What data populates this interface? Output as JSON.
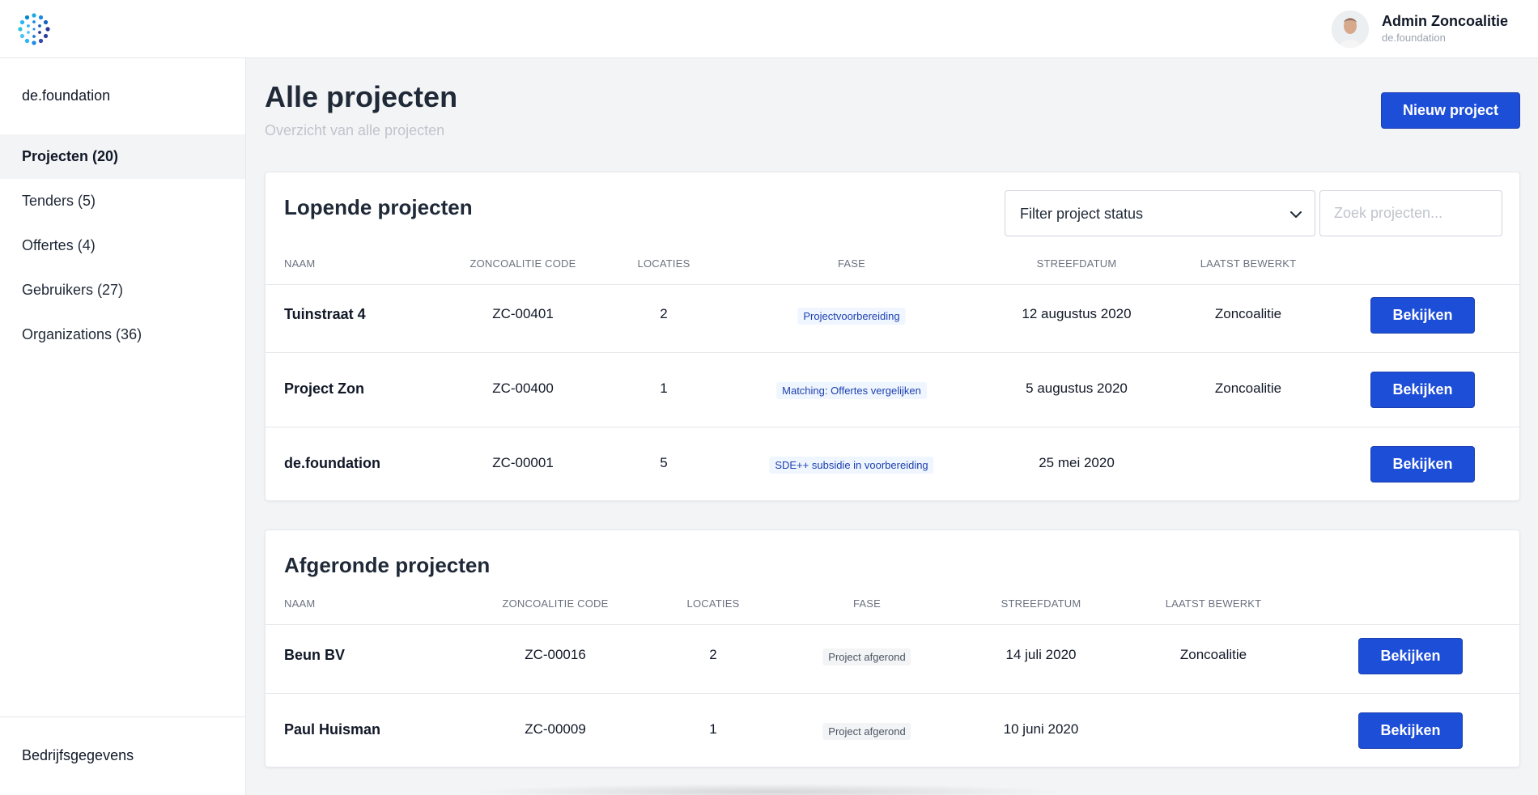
{
  "user": {
    "name": "Admin Zoncoalitie",
    "org": "de.foundation"
  },
  "sidebar": {
    "org_name": "de.foundation",
    "items": [
      {
        "label": "Projecten (20)",
        "active": true
      },
      {
        "label": "Tenders (5)"
      },
      {
        "label": "Offertes (4)"
      },
      {
        "label": "Gebruikers (27)"
      },
      {
        "label": "Organizations (36)"
      }
    ],
    "footer_label": "Bedrijfsgegevens"
  },
  "page": {
    "title": "Alle projecten",
    "subtitle": "Overzicht van alle projecten",
    "new_button": "Nieuw project"
  },
  "running": {
    "title": "Lopende projecten",
    "filter_label": "Filter project status",
    "search_placeholder": "Zoek projecten...",
    "columns": [
      "Naam",
      "Zoncoalitie code",
      "Locaties",
      "Fase",
      "Streefdatum",
      "Laatst bewerkt"
    ],
    "rows": [
      {
        "name": "Tuinstraat 4",
        "code": "ZC-00401",
        "locations": "2",
        "phase": "Projectvoorbereiding",
        "target_date": "12 augustus 2020",
        "last_edited": "Zoncoalitie",
        "action": "Bekijken"
      },
      {
        "name": "Project Zon",
        "code": "ZC-00400",
        "locations": "1",
        "phase": "Matching: Offertes vergelijken",
        "target_date": "5 augustus 2020",
        "last_edited": "Zoncoalitie",
        "action": "Bekijken"
      },
      {
        "name": "de.foundation",
        "code": "ZC-00001",
        "locations": "5",
        "phase": "SDE++ subsidie in voorbereiding",
        "target_date": "25 mei 2020",
        "last_edited": "",
        "action": "Bekijken"
      }
    ]
  },
  "completed": {
    "title": "Afgeronde projecten",
    "columns": [
      "Naam",
      "Zoncoalitie code",
      "Locaties",
      "Fase",
      "Streefdatum",
      "Laatst bewerkt"
    ],
    "rows": [
      {
        "name": "Beun BV",
        "code": "ZC-00016",
        "locations": "2",
        "phase": "Project afgerond",
        "target_date": "14 juli 2020",
        "last_edited": "Zoncoalitie",
        "action": "Bekijken"
      },
      {
        "name": "Paul Huisman",
        "code": "ZC-00009",
        "locations": "1",
        "phase": "Project afgerond",
        "target_date": "10 juni 2020",
        "last_edited": "",
        "action": "Bekijken"
      }
    ]
  },
  "colors": {
    "primary": "#1d4ed8",
    "badge_blue_bg": "#eff6ff",
    "badge_blue_text": "#1e40af",
    "badge_gray_bg": "#f3f4f6"
  }
}
